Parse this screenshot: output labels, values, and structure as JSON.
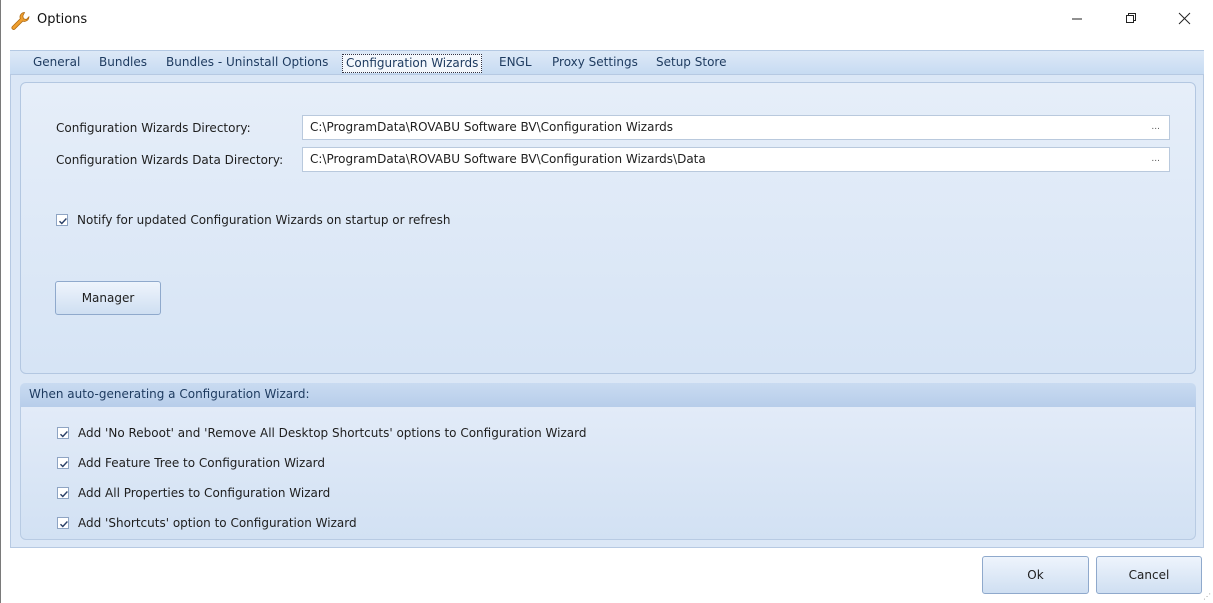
{
  "window": {
    "title": "Options",
    "icon": "wrench-icon"
  },
  "tabs": [
    {
      "label": "General"
    },
    {
      "label": "Bundles"
    },
    {
      "label": "Bundles - Uninstall Options"
    },
    {
      "label": "Configuration Wizards",
      "active": true
    },
    {
      "label": "ENGL"
    },
    {
      "label": "Proxy Settings"
    },
    {
      "label": "Setup Store"
    }
  ],
  "config": {
    "dir_label": "Configuration Wizards Directory:",
    "dir_value": "C:\\ProgramData\\ROVABU Software BV\\Configuration Wizards",
    "data_dir_label": "Configuration Wizards Data Directory:",
    "data_dir_value": "C:\\ProgramData\\ROVABU Software BV\\Configuration Wizards\\Data",
    "browse_label": "...",
    "notify_label": "Notify for updated Configuration Wizards on startup or refresh",
    "notify_checked": true,
    "manager_label": "Manager"
  },
  "autogen": {
    "heading": "When auto-generating a Configuration Wizard:",
    "options": [
      {
        "label": "Add 'No Reboot' and 'Remove All Desktop Shortcuts' options to Configuration Wizard",
        "checked": true
      },
      {
        "label": "Add Feature Tree to Configuration Wizard",
        "checked": true
      },
      {
        "label": "Add All Properties to Configuration Wizard",
        "checked": true
      },
      {
        "label": "Add 'Shortcuts' option to Configuration Wizard",
        "checked": true
      }
    ]
  },
  "footer": {
    "ok_label": "Ok",
    "cancel_label": "Cancel"
  },
  "colors": {
    "accent": "#1d3a5f",
    "panel": "#dbe7f6",
    "header": "#c9dbf1"
  }
}
